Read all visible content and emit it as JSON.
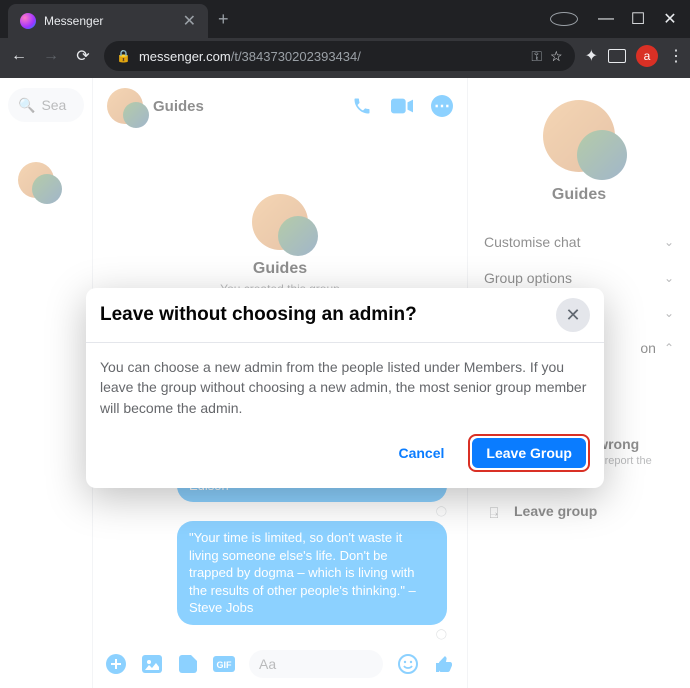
{
  "browser": {
    "tab_title": "Messenger",
    "url_domain": "messenger.com",
    "url_path": "/t/3843730202393434/",
    "profile_letter": "a"
  },
  "left": {
    "search_placeholder": "Sea"
  },
  "chat": {
    "header_title": "Guides",
    "center_title": "Guides",
    "center_sub": "You created this group",
    "msg1": "success when they gave up.\"– Thomas A. Edison",
    "msg2": "\"Your time is limited, so don't waste it living someone else's life. Don't be trapped by dogma – which is living with the results of other people's thinking.\" – Steve Jobs",
    "composer_placeholder": "Aa"
  },
  "right": {
    "title": "Guides",
    "item_customise": "Customise chat",
    "item_group_options": "Group options",
    "item_privacy_partial": "on",
    "something_title": "Something's wrong",
    "something_desc": "Give feedback and report the conversation",
    "leave_group": "Leave group"
  },
  "dialog": {
    "title": "Leave without choosing an admin?",
    "body": "You can choose a new admin from the people listed under Members. If you leave the group without choosing a new admin, the most senior group member will become the admin.",
    "cancel": "Cancel",
    "primary": "Leave Group"
  }
}
